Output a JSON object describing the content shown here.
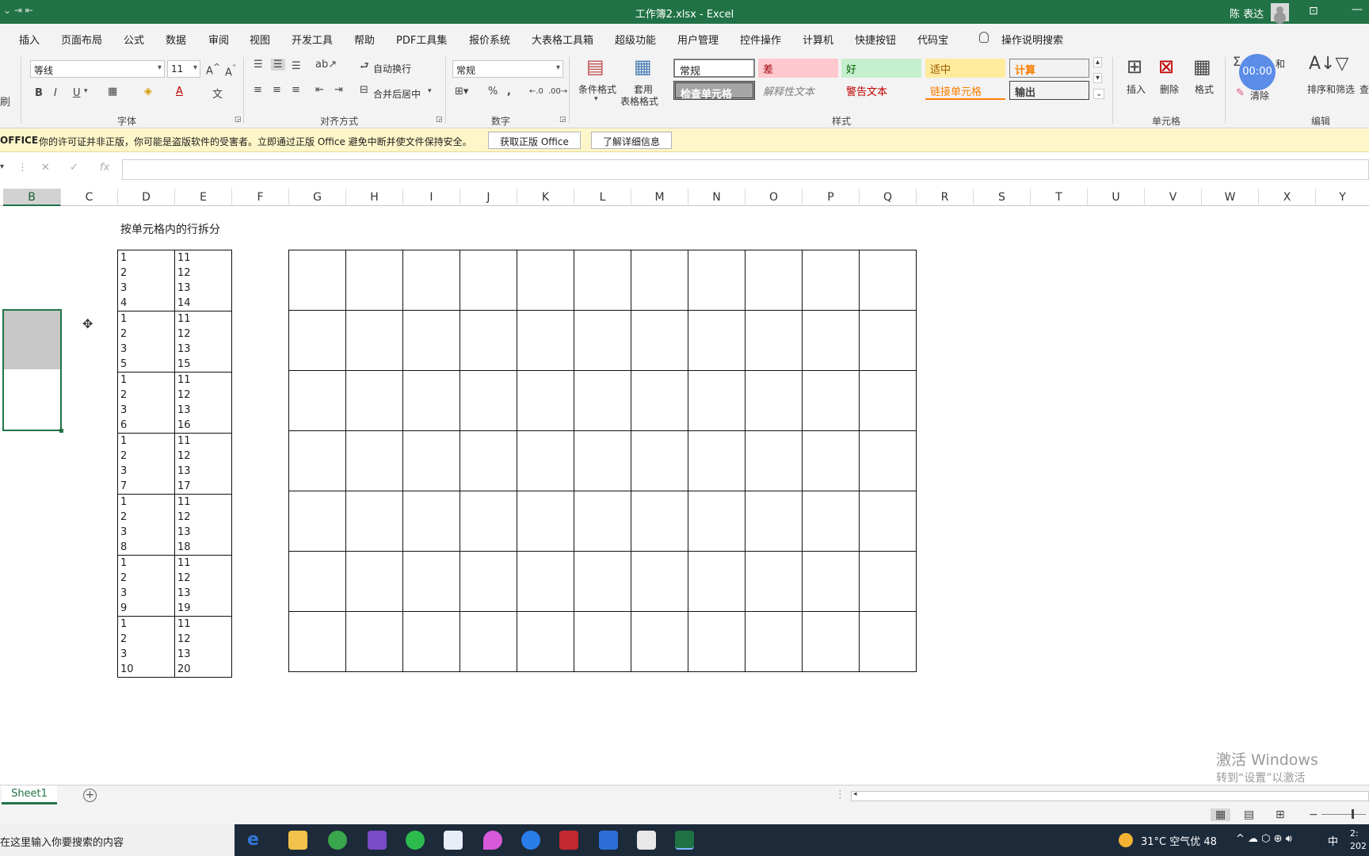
{
  "window": {
    "title": "工作簿2.xlsx  -  Excel",
    "user": "陈 表达"
  },
  "tabs": [
    "插入",
    "页面布局",
    "公式",
    "数据",
    "审阅",
    "视图",
    "开发工具",
    "帮助",
    "PDF工具集",
    "报价系统",
    "大表格工具箱",
    "超级功能",
    "用户管理",
    "控件操作",
    "计算机",
    "快捷按钮",
    "代码宝"
  ],
  "tell_me": "操作说明搜索",
  "ribbon": {
    "font_name": "等线",
    "font_size": "11",
    "wrap_text": "自动换行",
    "merge_center": "合并后居中",
    "number_format": "常规",
    "conditional_format": "条件格式",
    "table_format_1": "套用",
    "table_format_2": "表格格式",
    "insert": "插入",
    "delete": "删除",
    "format": "格式",
    "clear": "清除",
    "sort_filter": "排序和筛选",
    "find": "查",
    "sum_label": "和",
    "timer": "00:00",
    "groups": {
      "font": "字体",
      "alignment": "对齐方式",
      "number": "数字",
      "styles": "样式",
      "cells": "单元格",
      "editing": "编辑"
    },
    "styles": {
      "normal": "常规",
      "bad": "差",
      "good": "好",
      "neutral": "适中",
      "calculation": "计算",
      "check_cell": "检查单元格",
      "explanatory": "解释性文本",
      "warning": "警告文本",
      "linked_cell": "链接单元格",
      "output": "输出"
    }
  },
  "notice": {
    "label": "OFFICE",
    "message": "你的许可证并非正版，你可能是盗版软件的受害者。立即通过正版 Office 避免中断并使文件保持安全。",
    "button_get": "获取正版 Office",
    "button_learn": "了解详细信息"
  },
  "columns": [
    "B",
    "C",
    "D",
    "E",
    "F",
    "G",
    "H",
    "I",
    "J",
    "K",
    "L",
    "M",
    "N",
    "O",
    "P",
    "Q",
    "R",
    "S",
    "T",
    "U",
    "V",
    "W",
    "X",
    "Y"
  ],
  "selected_column": "B",
  "sheet": {
    "heading": "按单元格内的行拆分",
    "rows": [
      {
        "d": [
          "1",
          "2",
          "3",
          "4"
        ],
        "e": [
          "11",
          "12",
          "13",
          "14"
        ]
      },
      {
        "d": [
          "1",
          "2",
          "3",
          "5"
        ],
        "e": [
          "11",
          "12",
          "13",
          "15"
        ]
      },
      {
        "d": [
          "1",
          "2",
          "3",
          "6"
        ],
        "e": [
          "11",
          "12",
          "13",
          "16"
        ]
      },
      {
        "d": [
          "1",
          "2",
          "3",
          "7"
        ],
        "e": [
          "11",
          "12",
          "13",
          "17"
        ]
      },
      {
        "d": [
          "1",
          "2",
          "3",
          "8"
        ],
        "e": [
          "11",
          "12",
          "13",
          "18"
        ]
      },
      {
        "d": [
          "1",
          "2",
          "3",
          "9"
        ],
        "e": [
          "11",
          "12",
          "13",
          "19"
        ]
      },
      {
        "d": [
          "1",
          "2",
          "3",
          "10"
        ],
        "e": [
          "11",
          "12",
          "13",
          "20"
        ]
      }
    ],
    "empty_grid_rows": 7,
    "empty_grid_cols": 11
  },
  "watermark": {
    "line1": "激活 Windows",
    "line2": "转到“设置”以激活 Windows。"
  },
  "sheet_tab": "Sheet1",
  "taskbar": {
    "search_placeholder": "在这里输入你要搜索的内容",
    "weather": "31°C  空气优 48",
    "ime": "中",
    "clock_line1": "2:",
    "clock_line2": "202"
  },
  "colors": {
    "excel_green": "#217346",
    "bad_bg": "#ffc7ce",
    "good_bg": "#c6efce",
    "neutral_bg": "#ffeb9c",
    "check_bg": "#a5a5a5"
  }
}
